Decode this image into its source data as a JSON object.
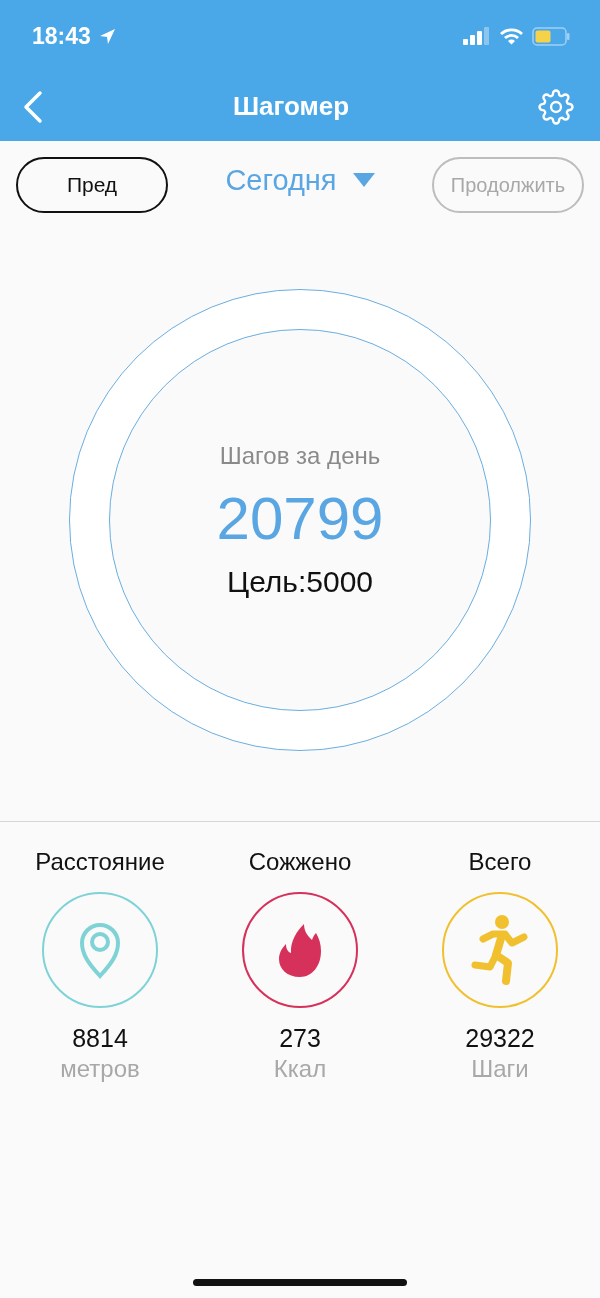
{
  "status_bar": {
    "time": "18:43"
  },
  "nav": {
    "title": "Шагомер"
  },
  "date_bar": {
    "prev": {
      "label": "Пред",
      "disabled": false
    },
    "period": "Сегодня",
    "next": {
      "label": "Продолжить",
      "disabled": true
    }
  },
  "daily": {
    "label": "Шагов за день",
    "steps": "20799",
    "goal": "Цель:5000"
  },
  "stats": [
    {
      "kind": "distance",
      "title": "Расстояние",
      "value": "8814",
      "unit": "метров",
      "color": "#7fd3d6"
    },
    {
      "kind": "calories",
      "title": "Сожжено",
      "value": "273",
      "unit": "Ккал",
      "color": "#d6315a"
    },
    {
      "kind": "steps",
      "title": "Всего",
      "value": "29322",
      "unit": "Шаги",
      "color": "#f0c02f"
    }
  ]
}
